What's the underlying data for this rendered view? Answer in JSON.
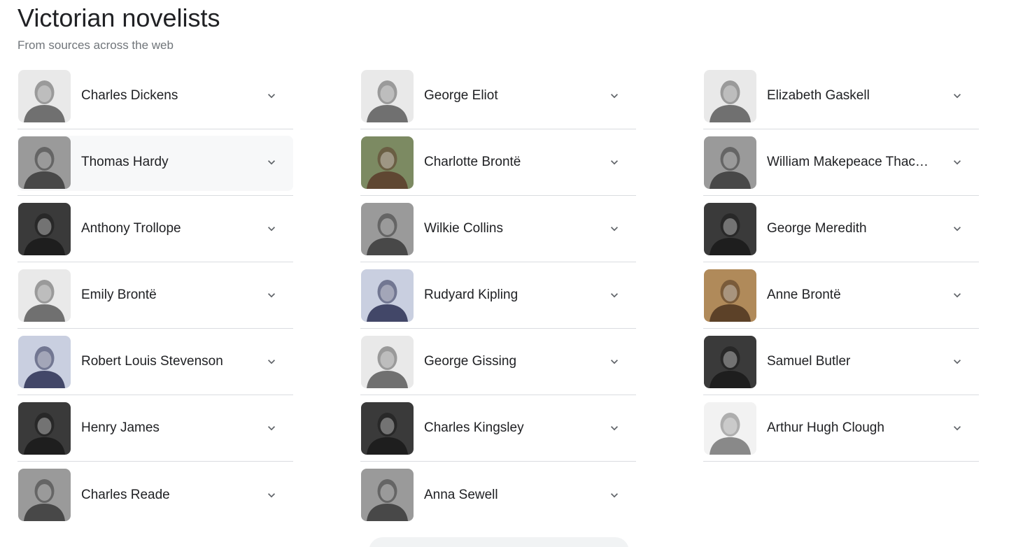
{
  "header": {
    "title": "Victorian novelists",
    "subtitle": "From sources across the web"
  },
  "columns": [
    [
      {
        "name": "Charles Dickens",
        "tone": "light"
      },
      {
        "name": "Thomas Hardy",
        "tone": "mid"
      },
      {
        "name": "Anthony Trollope",
        "tone": "dark"
      },
      {
        "name": "Emily Brontë",
        "tone": "light"
      },
      {
        "name": "Robert Louis Stevenson",
        "tone": "blue"
      },
      {
        "name": "Henry James",
        "tone": "dark"
      },
      {
        "name": "Charles Reade",
        "tone": "mid"
      }
    ],
    [
      {
        "name": "George Eliot",
        "tone": "light"
      },
      {
        "name": "Charlotte Brontë",
        "tone": "color"
      },
      {
        "name": "Wilkie Collins",
        "tone": "mid"
      },
      {
        "name": "Rudyard Kipling",
        "tone": "blue"
      },
      {
        "name": "George Gissing",
        "tone": "light"
      },
      {
        "name": "Charles Kingsley",
        "tone": "dark"
      },
      {
        "name": "Anna Sewell",
        "tone": "mid"
      }
    ],
    [
      {
        "name": "Elizabeth Gaskell",
        "tone": "light"
      },
      {
        "name": "William Makepeace Thackeray",
        "tone": "mid"
      },
      {
        "name": "George Meredith",
        "tone": "dark"
      },
      {
        "name": "Anne Brontë",
        "tone": "sepia"
      },
      {
        "name": "Samuel Butler",
        "tone": "dark"
      },
      {
        "name": "Arthur Hugh Clough",
        "tone": "pale"
      }
    ]
  ],
  "tones": {
    "light": {
      "bg": "#e9e9e9",
      "fg": "#5a5a5a"
    },
    "mid": {
      "bg": "#9a9a9a",
      "fg": "#3a3a3a"
    },
    "dark": {
      "bg": "#3a3a3a",
      "fg": "#1a1a1a"
    },
    "blue": {
      "bg": "#c9cfe0",
      "fg": "#2a2f52"
    },
    "color": {
      "bg": "#7c8a62",
      "fg": "#5b3b2a"
    },
    "sepia": {
      "bg": "#b08a5a",
      "fg": "#4e3420"
    },
    "pale": {
      "bg": "#f2f2f2",
      "fg": "#777777"
    }
  },
  "colors": {
    "title": "#202124",
    "subtitle": "#70757a",
    "divider": "#dadce0",
    "chevron": "#5f6368",
    "hover": "#f7f8f9"
  },
  "hovered_item": "Thomas Hardy",
  "icons": {
    "expand": "chevron-down-icon"
  }
}
